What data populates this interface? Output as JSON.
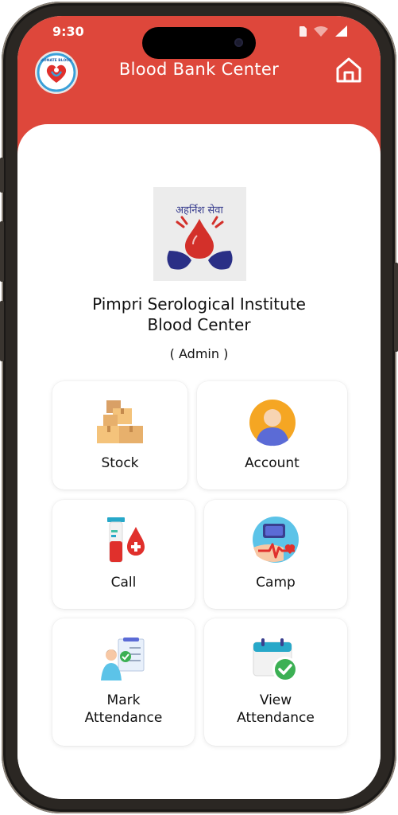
{
  "status_bar": {
    "time": "9:30"
  },
  "app": {
    "title": "Blood Bank Center",
    "logo_text": "DONATE BLOOD"
  },
  "institution": {
    "logo_text": "अहर्निश सेवा",
    "name_line1": "Pimpri Serological Institute",
    "name_line2": "Blood Center",
    "role": "( Admin )"
  },
  "menu": {
    "stock": {
      "label": "Stock",
      "icon": "boxes-icon"
    },
    "account": {
      "label": "Account",
      "icon": "user-avatar-icon"
    },
    "call": {
      "label": "Call",
      "icon": "test-tube-blood-icon"
    },
    "camp": {
      "label": "Camp",
      "icon": "blood-pressure-icon"
    },
    "mark_attendance": {
      "label_line1": "Mark",
      "label_line2": "Attendance",
      "icon": "clipboard-person-icon"
    },
    "view_attendance": {
      "label_line1": "View",
      "label_line2": "Attendance",
      "icon": "calendar-check-icon"
    }
  },
  "colors": {
    "header": "#de473b",
    "background": "#ffffff",
    "text": "#111111"
  }
}
